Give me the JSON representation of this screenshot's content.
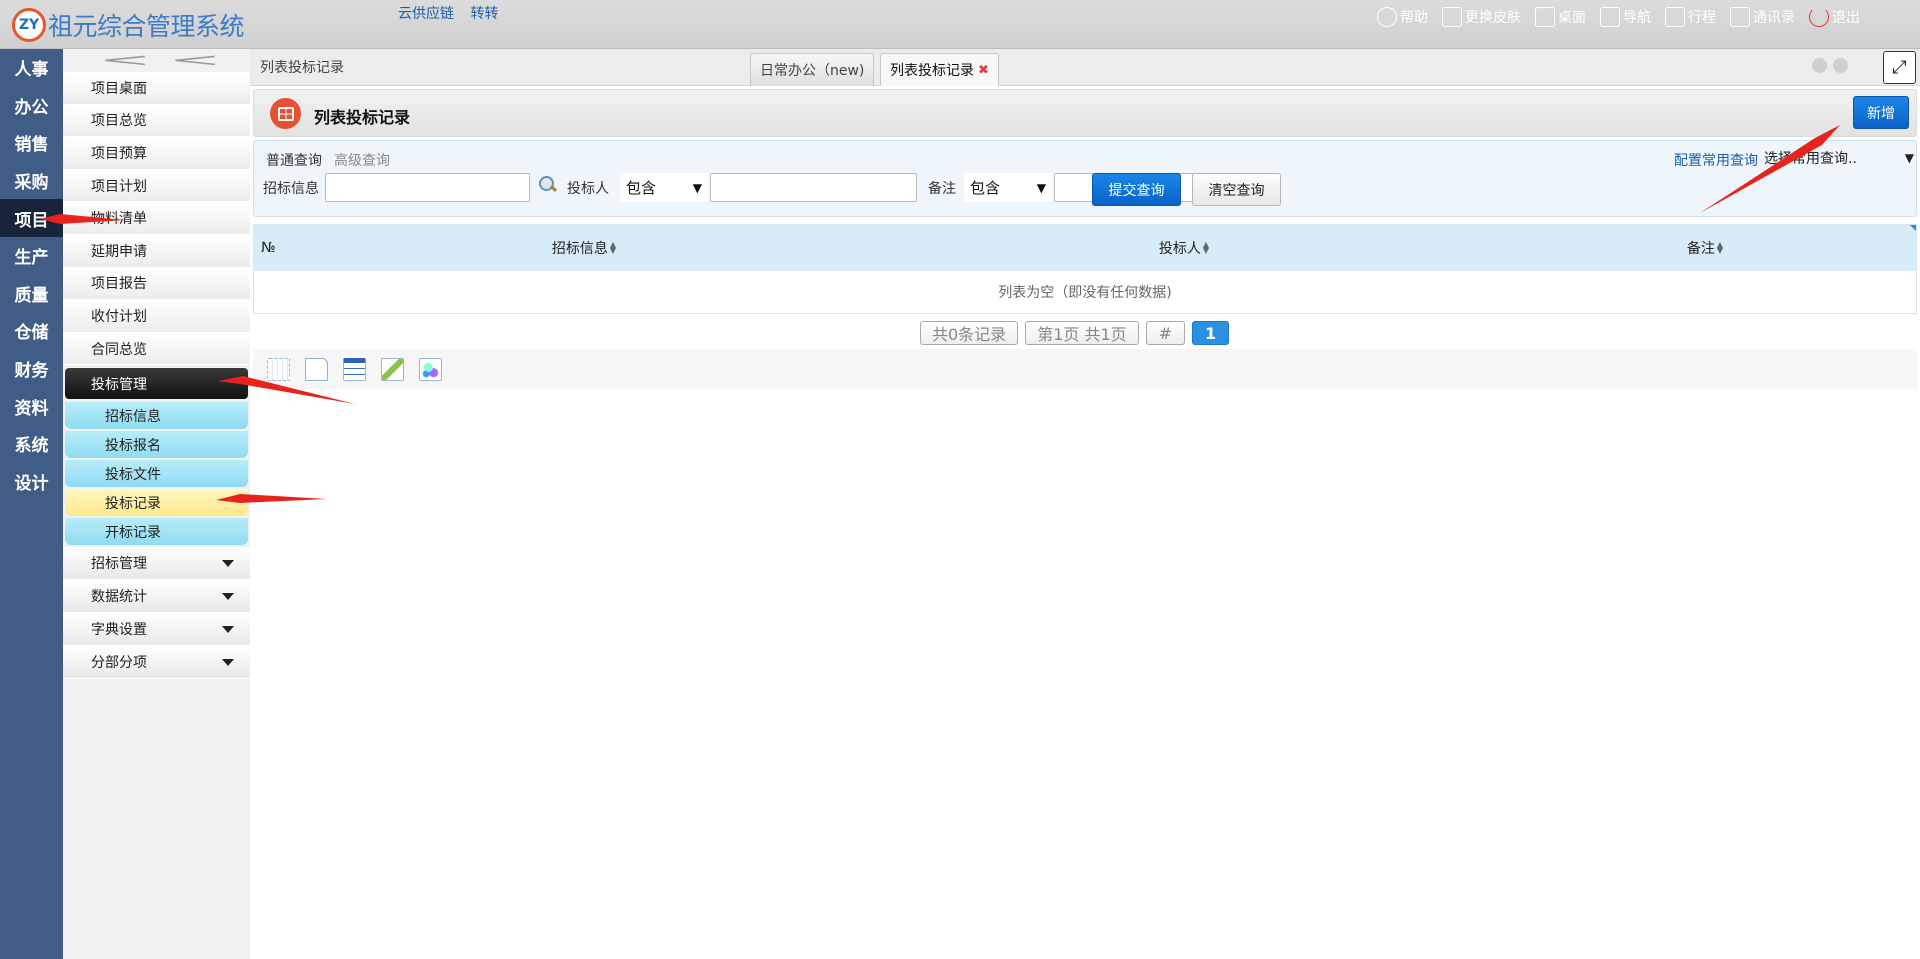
{
  "app": {
    "logo_mark": "ZY",
    "title": "祖元综合管理系统",
    "top_links": [
      "云供应链",
      "转转"
    ],
    "top_menu": [
      {
        "label": "帮助",
        "icon": "help-icon"
      },
      {
        "label": "更换皮肤",
        "icon": "shirt-icon"
      },
      {
        "label": "桌面",
        "icon": "home-icon"
      },
      {
        "label": "导航",
        "icon": "grid-icon"
      },
      {
        "label": "行程",
        "icon": "calendar-icon"
      },
      {
        "label": "通讯录",
        "icon": "contacts-icon"
      },
      {
        "label": "退出",
        "icon": "power-icon"
      }
    ]
  },
  "categories": [
    "人事",
    "办公",
    "销售",
    "采购",
    "项目",
    "生产",
    "质量",
    "仓储",
    "财务",
    "资料",
    "系统",
    "设计"
  ],
  "active_category": "项目",
  "sidebar": {
    "items": [
      "项目桌面",
      "项目总览",
      "项目预算",
      "项目计划",
      "物料清单",
      "延期申请",
      "项目报告",
      "收付计划",
      "合同总览"
    ],
    "group": "投标管理",
    "sub_items": [
      "招标信息",
      "投标报名",
      "投标文件",
      "投标记录",
      "开标记录"
    ],
    "active_sub_item": "投标记录",
    "collapsed": [
      "招标管理",
      "数据统计",
      "字典设置",
      "分部分项"
    ]
  },
  "tabs": {
    "breadcrumb": "列表投标记录",
    "items": [
      {
        "label": "日常办公（new)"
      },
      {
        "label": "列表投标记录",
        "close": "✖"
      }
    ]
  },
  "page": {
    "title": "列表投标记录",
    "add_button": "新增"
  },
  "query": {
    "tab_normal": "普通查询",
    "tab_advanced": "高级查询",
    "config_link": "配置常用查询",
    "common_select": "选择常用查询..",
    "fields": [
      {
        "label": "招标信息",
        "value": ""
      },
      {
        "label": "投标人",
        "op": "包含",
        "value": ""
      },
      {
        "label": "备注",
        "op": "包含",
        "value": ""
      }
    ],
    "submit": "提交查询",
    "clear": "清空查询"
  },
  "grid": {
    "columns": [
      "№",
      "招标信息",
      "投标人",
      "备注"
    ],
    "empty_text": "列表为空（即没有任何数据)"
  },
  "pager": {
    "total": "共0条记录",
    "pages": "第1页 共1页",
    "hash": "#",
    "current": "1"
  },
  "colors": {
    "category_bar": "#3f5d86",
    "accent_blue": "#0a62c7",
    "annotation_red": "#e8231d"
  }
}
